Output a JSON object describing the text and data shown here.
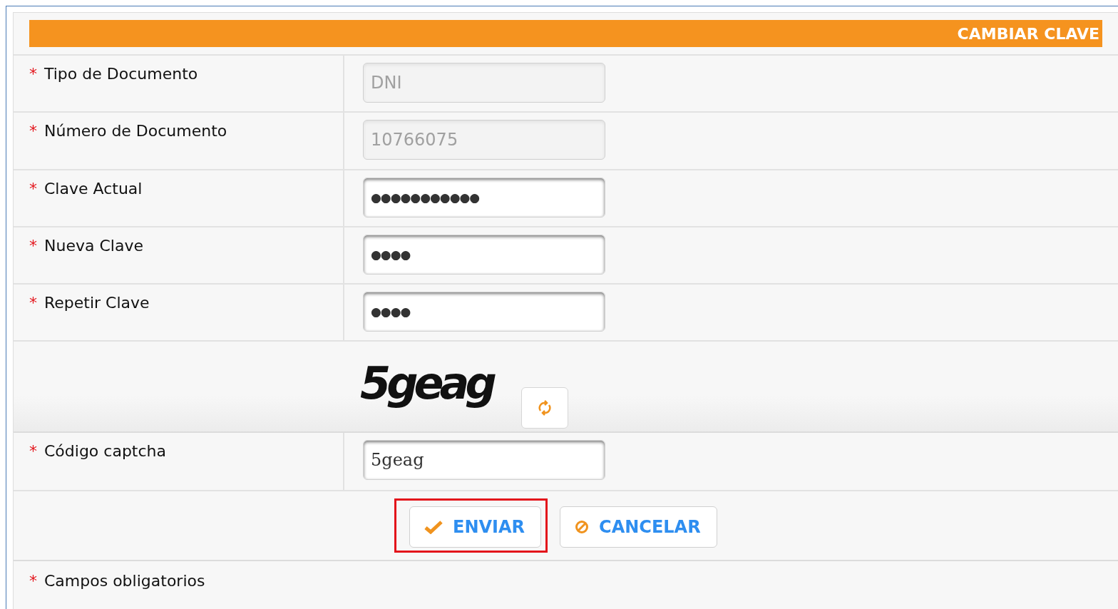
{
  "header": {
    "title": "CAMBIAR CLAVE"
  },
  "rows": [
    {
      "mark": "*",
      "label": "Tipo de Documento",
      "value": "DNI",
      "disabled": true
    },
    {
      "mark": "*",
      "label": "Número de Documento",
      "value": "10766075",
      "disabled": true
    },
    {
      "mark": "*",
      "label": "Clave Actual",
      "value": "●●●●●●●●●●●",
      "disabled": false
    },
    {
      "mark": "*",
      "label": "Nueva Clave",
      "value": "●●●●",
      "disabled": false
    },
    {
      "mark": "*",
      "label": "Repetir Clave",
      "value": "●●●●",
      "disabled": false
    }
  ],
  "captcha": {
    "code": "5geag"
  },
  "captcha_row": {
    "mark": "*",
    "label": "Código captcha",
    "value": "5geag",
    "disabled": false
  },
  "buttons": [
    {
      "kind": "submit",
      "label": "ENVIAR",
      "highlighted": true
    },
    {
      "kind": "cancel",
      "label": "CANCELAR",
      "highlighted": false
    }
  ],
  "footer": {
    "mark": "*",
    "text": "Campos obligatorios"
  }
}
